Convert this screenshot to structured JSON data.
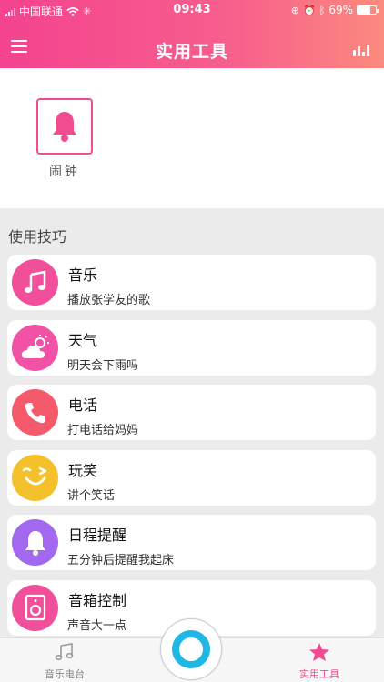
{
  "status_bar": {
    "carrier": "中国联通",
    "time": "09:43",
    "battery": "69%",
    "battery_level": 0.69
  },
  "nav": {
    "title": "实用工具"
  },
  "tools": [
    {
      "label": "闹钟",
      "icon": "bell-icon"
    }
  ],
  "section_title": "使用技巧",
  "tips": [
    {
      "title": "音乐",
      "subtitle": "播放张学友的歌",
      "color": "#f24f9a",
      "icon": "music-note-icon"
    },
    {
      "title": "天气",
      "subtitle": "明天会下雨吗",
      "color": "#f252a6",
      "icon": "cloud-sun-icon"
    },
    {
      "title": "电话",
      "subtitle": "打电话给妈妈",
      "color": "#f45a6c",
      "icon": "phone-icon"
    },
    {
      "title": "玩笑",
      "subtitle": "讲个笑话",
      "color": "#f4c02b",
      "icon": "wink-face-icon"
    },
    {
      "title": "日程提醒",
      "subtitle": "五分钟后提醒我起床",
      "color": "#a268f0",
      "icon": "bell-icon"
    },
    {
      "title": "音箱控制",
      "subtitle": "声音大一点",
      "color": "#f24f9a",
      "icon": "speaker-icon"
    }
  ],
  "tabbar": {
    "left_label": "音乐电台",
    "right_label": "实用工具"
  }
}
